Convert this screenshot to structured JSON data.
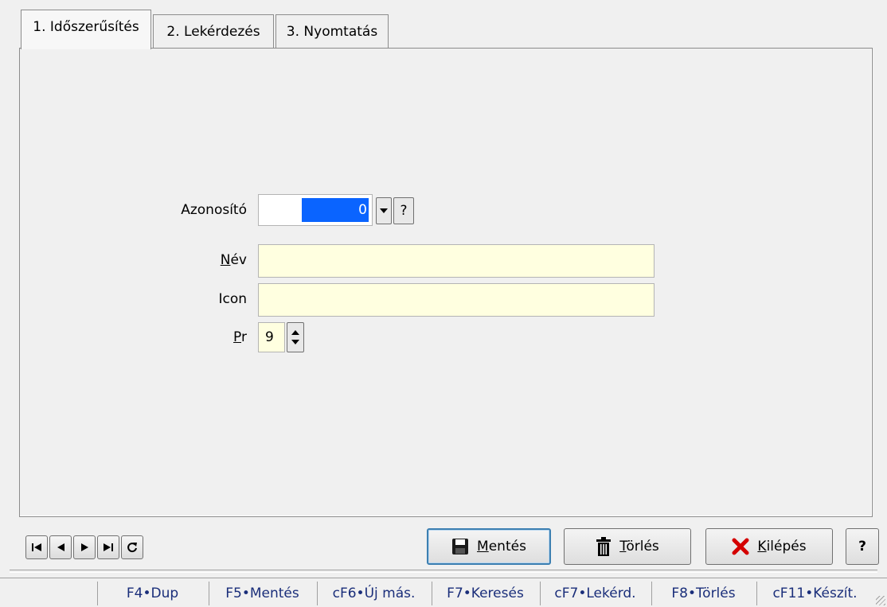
{
  "tabs": [
    {
      "label": "1. Időszerűsítés",
      "active": true
    },
    {
      "label": "2. Lekérdezés",
      "active": false
    },
    {
      "label": "3. Nyomtatás",
      "active": false
    }
  ],
  "form": {
    "azonosito_label": "Azonosító",
    "azonosito_value": "0",
    "azonosito_help": "?",
    "nev_label_u": "N",
    "nev_label_rest": "év",
    "nev_value": "",
    "icon_label": "Icon",
    "icon_value": "",
    "pr_label_u": "P",
    "pr_label_rest": "r",
    "pr_value": "9"
  },
  "buttons": {
    "mentes_u": "M",
    "mentes_rest": "entés",
    "torles_u": "T",
    "torles_rest": "örlés",
    "kilepes_u": "K",
    "kilepes_rest": "ilépés",
    "help": "?"
  },
  "icons": {
    "first": "first-record-icon",
    "prev": "previous-record-icon",
    "next": "next-record-icon",
    "last": "last-record-icon",
    "refresh": "refresh-icon",
    "save": "floppy-disk-icon",
    "delete": "trash-can-icon",
    "exit": "red-x-icon"
  },
  "colors": {
    "selection": "#0a64ff",
    "field_bg": "#ffffe0",
    "shortcut_text": "#1a2e7a",
    "exit_icon": "#d40000"
  },
  "statusbar": [
    "F4•Dup",
    "F5•Mentés",
    "cF6•Új más.",
    "F7•Keresés",
    "cF7•Lekérd.",
    "F8•Törlés",
    "cF11•Készít."
  ]
}
